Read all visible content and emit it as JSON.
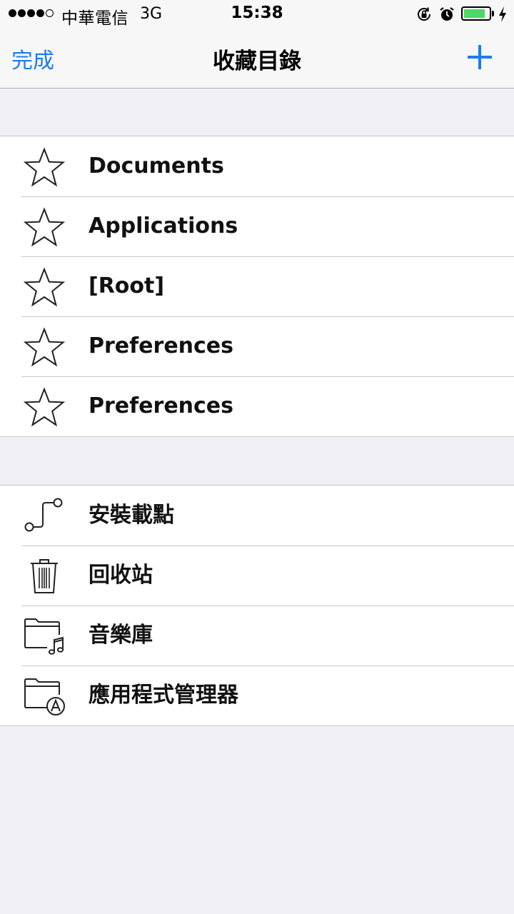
{
  "status_bar": {
    "carrier": "中華電信",
    "network": "3G",
    "time": "15:38",
    "signal_bars": 4,
    "signal_total": 5,
    "battery_level": 0.85,
    "battery_color": "#4cd964"
  },
  "nav": {
    "done_label": "完成",
    "title": "收藏目錄",
    "add_icon": "plus-icon",
    "tint_color": "#1a7cf4"
  },
  "favorites": [
    {
      "label": "Documents",
      "icon": "star-icon"
    },
    {
      "label": "Applications",
      "icon": "star-icon"
    },
    {
      "label": "[Root]",
      "icon": "star-icon"
    },
    {
      "label": "Preferences",
      "icon": "star-icon"
    },
    {
      "label": "Preferences",
      "icon": "star-icon"
    }
  ],
  "locations": [
    {
      "label": "安裝載點",
      "icon": "mount-point-icon"
    },
    {
      "label": "回收站",
      "icon": "trash-icon"
    },
    {
      "label": "音樂庫",
      "icon": "music-folder-icon"
    },
    {
      "label": "應用程式管理器",
      "icon": "app-folder-icon"
    }
  ]
}
